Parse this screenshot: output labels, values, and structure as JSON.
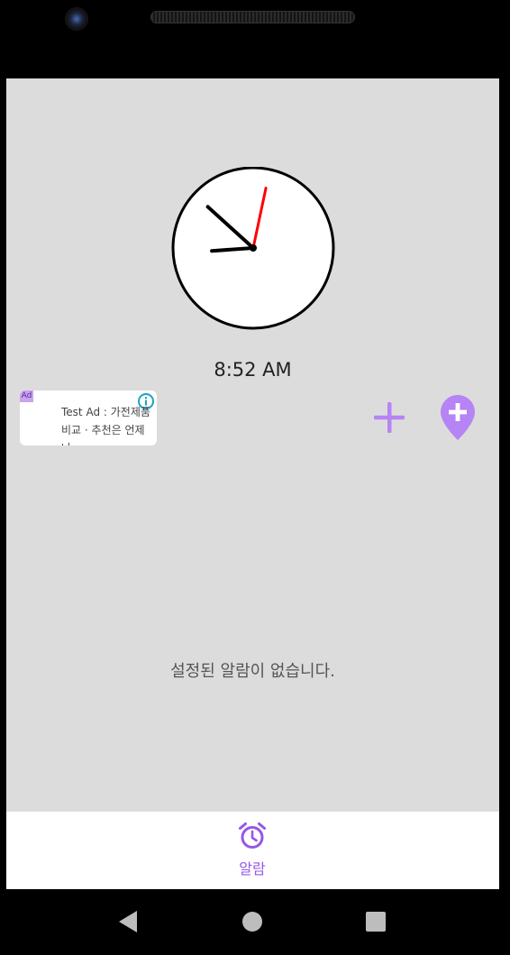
{
  "clock": {
    "hour": 8,
    "minute": 52,
    "second": 2
  },
  "time_display": "8:52 AM",
  "ad": {
    "badge": "Ad",
    "text": "Test Ad : 가전제품 비교 · 추천은 언제나"
  },
  "actions": {
    "add": "plus-icon",
    "add_location": "add-location-pin-icon"
  },
  "empty_message": "설정된 알람이 없습니다.",
  "tabs": [
    {
      "label": "알람",
      "icon": "alarm-clock-icon",
      "active": true
    }
  ],
  "colors": {
    "accent": "#9457e8",
    "accent_light": "#b684f5",
    "second_hand": "#ff0000",
    "background": "#dcdcdc"
  }
}
